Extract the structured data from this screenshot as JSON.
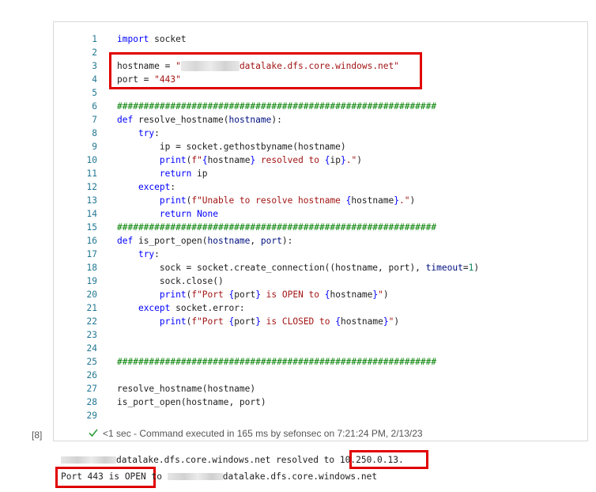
{
  "cell": {
    "execution_index": "[8]",
    "status_text": "<1 sec - Command executed in 165 ms by sefonsec on 7:21:24 PM, 2/13/23",
    "lines": [
      {
        "no": "1",
        "tokens": [
          {
            "t": "keyword",
            "v": "import"
          },
          {
            "t": "text",
            "v": " socket"
          }
        ]
      },
      {
        "no": "2",
        "tokens": []
      },
      {
        "no": "3",
        "tokens": [
          {
            "t": "text",
            "v": "hostname = "
          },
          {
            "t": "string",
            "v": "\""
          },
          {
            "t": "blur",
            "v": "xxxxxxxxxxx"
          },
          {
            "t": "string",
            "v": "datalake.dfs.core.windows.net\""
          }
        ]
      },
      {
        "no": "4",
        "tokens": [
          {
            "t": "text",
            "v": "port = "
          },
          {
            "t": "string",
            "v": "\"443\""
          }
        ]
      },
      {
        "no": "5",
        "tokens": []
      },
      {
        "no": "6",
        "tokens": [
          {
            "t": "comment",
            "v": "############################################################"
          }
        ]
      },
      {
        "no": "7",
        "tokens": [
          {
            "t": "keyword",
            "v": "def"
          },
          {
            "t": "text",
            "v": " resolve_hostname("
          },
          {
            "t": "param",
            "v": "hostname"
          },
          {
            "t": "text",
            "v": "):"
          }
        ]
      },
      {
        "no": "8",
        "tokens": [
          {
            "t": "text",
            "v": "    "
          },
          {
            "t": "keyword",
            "v": "try"
          },
          {
            "t": "text",
            "v": ":"
          }
        ]
      },
      {
        "no": "9",
        "tokens": [
          {
            "t": "text",
            "v": "        ip = socket.gethostbyname(hostname)"
          }
        ]
      },
      {
        "no": "10",
        "tokens": [
          {
            "t": "text",
            "v": "        "
          },
          {
            "t": "keyword",
            "v": "print"
          },
          {
            "t": "text",
            "v": "("
          },
          {
            "t": "string",
            "v": "f\""
          },
          {
            "t": "keyword",
            "v": "{"
          },
          {
            "t": "text",
            "v": "hostname"
          },
          {
            "t": "keyword",
            "v": "}"
          },
          {
            "t": "string",
            "v": " resolved to "
          },
          {
            "t": "keyword",
            "v": "{"
          },
          {
            "t": "text",
            "v": "ip"
          },
          {
            "t": "keyword",
            "v": "}"
          },
          {
            "t": "string",
            "v": ".\""
          },
          {
            "t": "text",
            "v": ")"
          }
        ]
      },
      {
        "no": "11",
        "tokens": [
          {
            "t": "text",
            "v": "        "
          },
          {
            "t": "keyword",
            "v": "return"
          },
          {
            "t": "text",
            "v": " ip"
          }
        ]
      },
      {
        "no": "12",
        "tokens": [
          {
            "t": "text",
            "v": "    "
          },
          {
            "t": "keyword",
            "v": "except"
          },
          {
            "t": "text",
            "v": ":"
          }
        ]
      },
      {
        "no": "13",
        "tokens": [
          {
            "t": "text",
            "v": "        "
          },
          {
            "t": "keyword",
            "v": "print"
          },
          {
            "t": "text",
            "v": "("
          },
          {
            "t": "string",
            "v": "f\"Unable to resolve hostname "
          },
          {
            "t": "keyword",
            "v": "{"
          },
          {
            "t": "text",
            "v": "hostname"
          },
          {
            "t": "keyword",
            "v": "}"
          },
          {
            "t": "string",
            "v": ".\""
          },
          {
            "t": "text",
            "v": ")"
          }
        ]
      },
      {
        "no": "14",
        "tokens": [
          {
            "t": "text",
            "v": "        "
          },
          {
            "t": "keyword",
            "v": "return"
          },
          {
            "t": "text",
            "v": " "
          },
          {
            "t": "keyword",
            "v": "None"
          }
        ]
      },
      {
        "no": "15",
        "tokens": [
          {
            "t": "comment",
            "v": "############################################################"
          }
        ]
      },
      {
        "no": "16",
        "tokens": [
          {
            "t": "keyword",
            "v": "def"
          },
          {
            "t": "text",
            "v": " is_port_open("
          },
          {
            "t": "param",
            "v": "hostname"
          },
          {
            "t": "text",
            "v": ", "
          },
          {
            "t": "param",
            "v": "port"
          },
          {
            "t": "text",
            "v": "):"
          }
        ]
      },
      {
        "no": "17",
        "tokens": [
          {
            "t": "text",
            "v": "    "
          },
          {
            "t": "keyword",
            "v": "try"
          },
          {
            "t": "text",
            "v": ":"
          }
        ]
      },
      {
        "no": "18",
        "tokens": [
          {
            "t": "text",
            "v": "        sock = socket.create_connection((hostname, port), "
          },
          {
            "t": "param",
            "v": "timeout"
          },
          {
            "t": "text",
            "v": "="
          },
          {
            "t": "number",
            "v": "1"
          },
          {
            "t": "text",
            "v": ")"
          }
        ]
      },
      {
        "no": "19",
        "tokens": [
          {
            "t": "text",
            "v": "        sock.close()"
          }
        ]
      },
      {
        "no": "20",
        "tokens": [
          {
            "t": "text",
            "v": "        "
          },
          {
            "t": "keyword",
            "v": "print"
          },
          {
            "t": "text",
            "v": "("
          },
          {
            "t": "string",
            "v": "f\"Port "
          },
          {
            "t": "keyword",
            "v": "{"
          },
          {
            "t": "text",
            "v": "port"
          },
          {
            "t": "keyword",
            "v": "}"
          },
          {
            "t": "string",
            "v": " is OPEN to "
          },
          {
            "t": "keyword",
            "v": "{"
          },
          {
            "t": "text",
            "v": "hostname"
          },
          {
            "t": "keyword",
            "v": "}"
          },
          {
            "t": "string",
            "v": "\""
          },
          {
            "t": "text",
            "v": ")"
          }
        ]
      },
      {
        "no": "21",
        "tokens": [
          {
            "t": "text",
            "v": "    "
          },
          {
            "t": "keyword",
            "v": "except"
          },
          {
            "t": "text",
            "v": " socket.error:"
          }
        ]
      },
      {
        "no": "22",
        "tokens": [
          {
            "t": "text",
            "v": "        "
          },
          {
            "t": "keyword",
            "v": "print"
          },
          {
            "t": "text",
            "v": "("
          },
          {
            "t": "string",
            "v": "f\"Port "
          },
          {
            "t": "keyword",
            "v": "{"
          },
          {
            "t": "text",
            "v": "port"
          },
          {
            "t": "keyword",
            "v": "}"
          },
          {
            "t": "string",
            "v": " is CLOSED to "
          },
          {
            "t": "keyword",
            "v": "{"
          },
          {
            "t": "text",
            "v": "hostname"
          },
          {
            "t": "keyword",
            "v": "}"
          },
          {
            "t": "string",
            "v": "\""
          },
          {
            "t": "text",
            "v": ")"
          }
        ]
      },
      {
        "no": "23",
        "tokens": []
      },
      {
        "no": "24",
        "tokens": []
      },
      {
        "no": "25",
        "tokens": [
          {
            "t": "comment",
            "v": "############################################################"
          }
        ]
      },
      {
        "no": "26",
        "tokens": []
      },
      {
        "no": "27",
        "tokens": [
          {
            "t": "text",
            "v": "resolve_hostname(hostname)"
          }
        ]
      },
      {
        "no": "28",
        "tokens": [
          {
            "t": "text",
            "v": "is_port_open(hostname, port)"
          }
        ]
      },
      {
        "no": "29",
        "tokens": []
      }
    ]
  },
  "output": {
    "line1_host": "datalake.dfs.core.windows.net",
    "line1_mid": " resolved to ",
    "line1_ip": "10.250.0.13.",
    "line2_open": "Port 443 is OPEN",
    "line2_to": " to ",
    "line2_host": "datalake.dfs.core.windows.net"
  },
  "colors": {
    "highlight_box": "#e00000",
    "keyword": "#0000ff",
    "string": "#a31515",
    "comment": "#008000",
    "line_number": "#237893",
    "success_check": "#2e9e3e"
  }
}
